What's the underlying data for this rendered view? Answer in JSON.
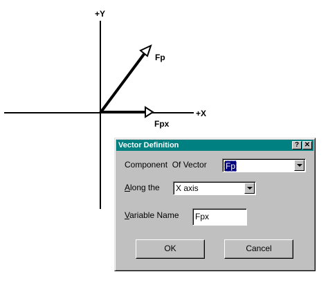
{
  "diagram": {
    "y_axis_label": "+Y",
    "x_axis_label": "+X",
    "vector_label": "Fp",
    "component_label": "Fpx"
  },
  "dialog": {
    "title": "Vector Definition",
    "help_glyph": "?",
    "close_glyph": "✕",
    "component_label": "Component  Of Vector",
    "component_value": "Fp",
    "along_label_underlined": "A",
    "along_label_rest": "long the",
    "along_value": "X axis",
    "varname_label_underlined": "V",
    "varname_label_rest": "ariable Name",
    "varname_value": "Fpx",
    "ok_label": "OK",
    "cancel_label": "Cancel"
  },
  "icons": {
    "dropdown": "chevron-down-icon",
    "help": "help-icon",
    "close": "close-icon"
  },
  "colors": {
    "titlebar": "#008080",
    "dialog_face": "#c0c0c0",
    "selection": "#000080"
  }
}
